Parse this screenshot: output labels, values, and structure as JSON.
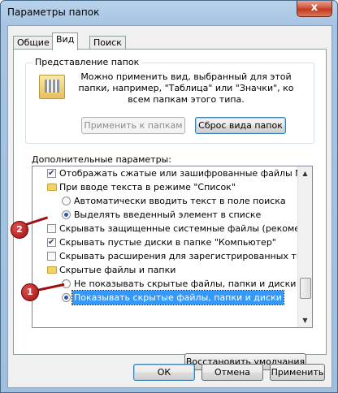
{
  "window": {
    "title": "Параметры папок",
    "close_glyph": "x"
  },
  "tabs": [
    "Общие",
    "Вид",
    "Поиск"
  ],
  "folder_view": {
    "group_title": "Представление папок",
    "description": "Можно применить вид, выбранный для этой папки, например, \"Таблица\" или \"Значки\", ко всем папкам этого типа.",
    "apply_button": "Применить к папкам",
    "reset_button": "Сброс вида папок"
  },
  "advanced": {
    "label": "Дополнительные параметры:",
    "items": [
      {
        "kind": "checkbox",
        "checked": true,
        "indent": 1,
        "label": "Отображать сжатые или зашифрованные файлы NTF"
      },
      {
        "kind": "folder",
        "indent": 1,
        "label": "При вводе текста в режиме \"Список\""
      },
      {
        "kind": "radio",
        "checked": false,
        "indent": 2,
        "label": "Автоматически вводить текст в поле поиска"
      },
      {
        "kind": "radio",
        "checked": true,
        "indent": 2,
        "label": "Выделять введенный элемент в списке"
      },
      {
        "kind": "checkbox",
        "checked": false,
        "indent": 1,
        "label": "Скрывать защищенные системные файлы (рекомен"
      },
      {
        "kind": "checkbox",
        "checked": true,
        "indent": 1,
        "label": "Скрывать пустые диски в папке \"Компьютер\""
      },
      {
        "kind": "checkbox",
        "checked": false,
        "indent": 1,
        "label": "Скрывать расширения для зарегистрированных типо"
      },
      {
        "kind": "folder",
        "indent": 1,
        "label": "Скрытые файлы и папки"
      },
      {
        "kind": "radio",
        "checked": false,
        "indent": 2,
        "label": "Не показывать скрытые файлы, папки и диски"
      },
      {
        "kind": "radio",
        "checked": true,
        "indent": 2,
        "label": "Показывать скрытые файлы, папки и диски",
        "selected": true
      }
    ]
  },
  "restore_button": "Восстановить умолчания",
  "footer": {
    "ok": "ОК",
    "cancel": "Отмена",
    "apply": "Применить"
  },
  "annotations": [
    {
      "label": "1"
    },
    {
      "label": "2"
    }
  ],
  "colors": {
    "selection": "#3399ff",
    "marker": "#9e1010"
  }
}
